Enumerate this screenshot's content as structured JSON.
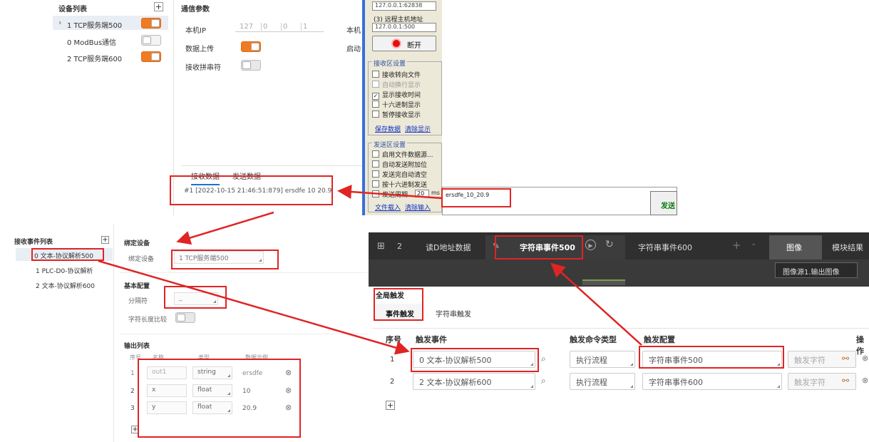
{
  "panel1": {
    "device_list_title": "设备列表",
    "plus": "+",
    "devices": [
      {
        "label": "1 TCP服务端500",
        "on": true,
        "chev": "›"
      },
      {
        "label": "0 ModBus通信",
        "on": false,
        "chev": ""
      },
      {
        "label": "2 TCP服务端600",
        "on": true,
        "chev": ""
      }
    ],
    "comm_title": "通信参数",
    "local_ip_label": "本机IP",
    "ip_parts": [
      "127",
      "0",
      "0",
      "1"
    ],
    "right_cut_1": "本机",
    "right_cut_2": "启动",
    "data_upload_label": "数据上传",
    "recv_concat_label": "接收拼串符",
    "tab_recv": "接收数据",
    "tab_send": "发送数据",
    "recv_line": "#1 [2022-10-15 21:46:51:879] ersdfe 10 20.9"
  },
  "panel2": {
    "remote_ip": "127.0.0.1:62838",
    "remote_host_label": "(3) 远程主机地址",
    "remote_host_value": "127.0.0.1:500",
    "disconnect": "断开",
    "recv_settings_title": "接收区设置",
    "recv_opts": [
      {
        "label": "接收转向文件",
        "checked": false
      },
      {
        "label": "自动换行显示",
        "checked": false
      },
      {
        "label": "显示接收时间",
        "checked": true
      },
      {
        "label": "十六进制显示",
        "checked": false
      },
      {
        "label": "暂停接收显示",
        "checked": false
      }
    ],
    "save_data": "保存数据",
    "clear_display": "清除显示",
    "send_settings_title": "发送区设置",
    "send_opts": [
      {
        "label": "启用文件数据源...",
        "checked": false
      },
      {
        "label": "自动发送附加位",
        "checked": false
      },
      {
        "label": "发送完自动清空",
        "checked": false
      },
      {
        "label": "按十六进制发送",
        "checked": false
      },
      {
        "label": "发送周期",
        "checked": false
      }
    ],
    "period_value": "20",
    "period_unit": "ms",
    "file_load": "文件载入",
    "clear_input": "清除输入",
    "send_input": "ersdfe_10_20.9",
    "send_button": "发送"
  },
  "panel3": {
    "event_list_title": "接收事件列表",
    "plus": "+",
    "events": [
      "0 文本-协议解析500",
      "1 PLC-D0-协议解析",
      "2 文本-协议解析600"
    ],
    "bind_title": "绑定设备",
    "bind_label": "绑定设备",
    "bind_value": "1 TCP服务端500",
    "basic_title": "基本配置",
    "separator_label": "分隔符",
    "separator_value": "_",
    "strlen_label": "字符长度比较",
    "output_title": "输出列表",
    "out_headers": [
      "序号",
      "名称",
      "类型",
      "数据示例"
    ],
    "outputs": [
      {
        "idx": "1",
        "name": "out1",
        "type": "string",
        "sample": "ersdfe"
      },
      {
        "idx": "2",
        "name": "x",
        "type": "float",
        "sample": "10"
      },
      {
        "idx": "3",
        "name": "y",
        "type": "float",
        "sample": "20.9"
      }
    ],
    "delete_icon": "⊗",
    "add": "+"
  },
  "panel4": {
    "top_num": "2",
    "tab_readd": "读D地址数据",
    "tab_str500": "字符串事件500",
    "tab_str600": "字符串事件600",
    "tab_image": "图像",
    "tab_module": "模块结果",
    "image_source": "图像源1.输出图像",
    "global_trigger": "全局触发",
    "event_trigger": "事件触发",
    "string_trigger": "字符串触发",
    "headers": [
      "序号",
      "触发事件",
      "触发命令类型",
      "触发配置",
      "操作"
    ],
    "rows": [
      {
        "idx": "1",
        "event": "0 文本-协议解析500",
        "cmd": "执行流程",
        "config": "字符串事件500",
        "trigger_char": "触发字符"
      },
      {
        "idx": "2",
        "event": "2 文本-协议解析600",
        "cmd": "执行流程",
        "config": "字符串事件600",
        "trigger_char": "触发字符"
      }
    ],
    "add": "+"
  },
  "colors": {
    "accent_red": "#e02424",
    "toggle_orange": "#f07b22",
    "dark_header": "#2f2f2f",
    "dark_bg": "#3a3a3a"
  }
}
